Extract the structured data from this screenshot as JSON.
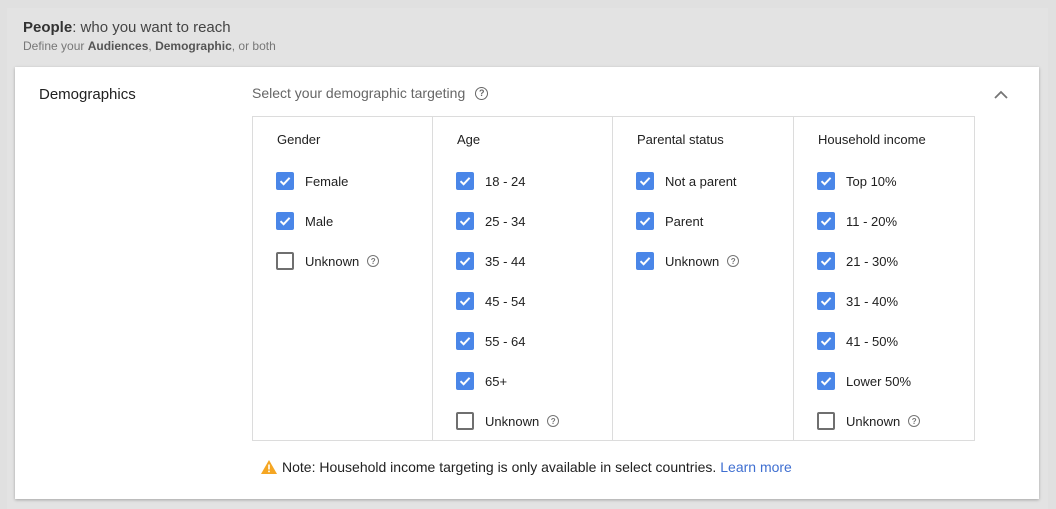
{
  "header": {
    "title_bold": "People",
    "title_rest": ": who you want to reach",
    "sub_prefix": "Define your ",
    "sub_audiences": "Audiences",
    "sub_sep": ", ",
    "sub_demographic": "Demographic",
    "sub_suffix": ", or both"
  },
  "section": {
    "label": "Demographics",
    "select_label": "Select your demographic targeting",
    "collapse_icon": "chevron-up-icon"
  },
  "columns": {
    "gender": {
      "title": "Gender",
      "options": [
        {
          "label": "Female",
          "checked": true
        },
        {
          "label": "Male",
          "checked": true
        },
        {
          "label": "Unknown",
          "checked": false,
          "help": true
        }
      ]
    },
    "age": {
      "title": "Age",
      "options": [
        {
          "label": "18 - 24",
          "checked": true
        },
        {
          "label": "25 - 34",
          "checked": true
        },
        {
          "label": "35 - 44",
          "checked": true
        },
        {
          "label": "45 - 54",
          "checked": true
        },
        {
          "label": "55 - 64",
          "checked": true
        },
        {
          "label": "65+",
          "checked": true
        },
        {
          "label": "Unknown",
          "checked": false,
          "help": true
        }
      ]
    },
    "parental": {
      "title": "Parental status",
      "options": [
        {
          "label": "Not a parent",
          "checked": true
        },
        {
          "label": "Parent",
          "checked": true
        },
        {
          "label": "Unknown",
          "checked": true,
          "help": true
        }
      ]
    },
    "income": {
      "title": "Household income",
      "options": [
        {
          "label": "Top 10%",
          "checked": true
        },
        {
          "label": "11 - 20%",
          "checked": true
        },
        {
          "label": "21 - 30%",
          "checked": true
        },
        {
          "label": "31 - 40%",
          "checked": true
        },
        {
          "label": "41 - 50%",
          "checked": true
        },
        {
          "label": "Lower 50%",
          "checked": true
        },
        {
          "label": "Unknown",
          "checked": false,
          "help": true
        }
      ]
    }
  },
  "note": {
    "icon": "warning-icon",
    "text": "Note: Household income targeting is only available in select countries.",
    "link": "Learn more"
  },
  "colors": {
    "checkbox_checked": "#4a86e8",
    "link": "#3f6fd1",
    "warning": "#f5a623"
  }
}
